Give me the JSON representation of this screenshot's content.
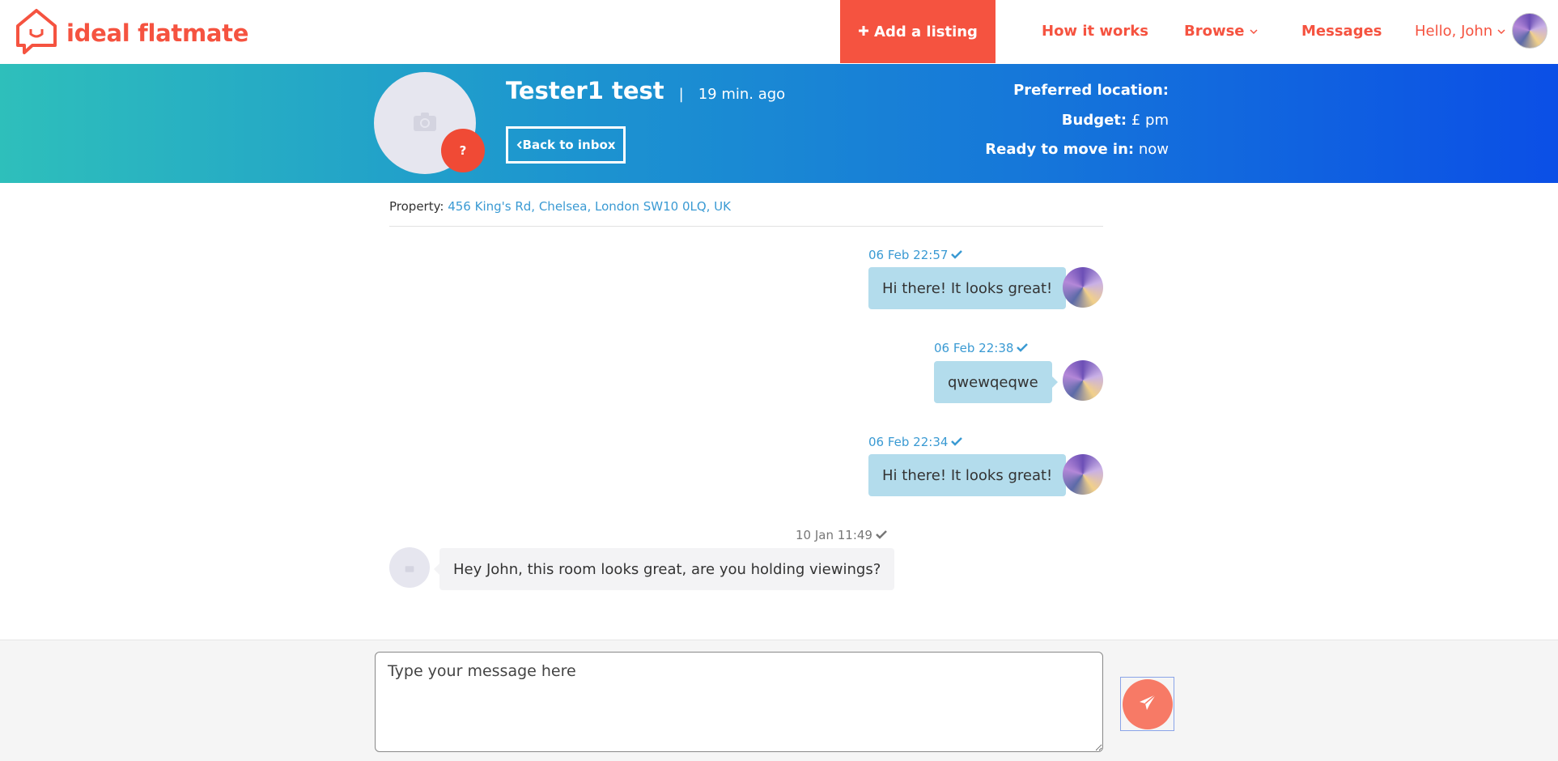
{
  "brand": {
    "name": "ideal flatmate",
    "color": "#f55340"
  },
  "nav": {
    "add_listing": "Add a listing",
    "how_it_works": "How it works",
    "browse": "Browse",
    "messages": "Messages",
    "greeting": "Hello, John"
  },
  "profile": {
    "name": "Tester1 test",
    "separator": "|",
    "last_seen": "19 min. ago",
    "badge": "?",
    "back_button": "Back to inbox",
    "preferred_location_label": "Preferred location:",
    "preferred_location_value": "",
    "budget_label": "Budget:",
    "budget_value": "£ pm",
    "move_in_label": "Ready to move in:",
    "move_in_value": "now"
  },
  "property": {
    "label": "Property:",
    "address": "456 King's Rd, Chelsea, London SW10 0LQ, UK"
  },
  "messages": [
    {
      "time": "06 Feb 22:57",
      "text": "Hi there! It looks great!",
      "sender": "me",
      "read": true
    },
    {
      "time": "06 Feb 22:38",
      "text": "qwewqeqwe",
      "sender": "me",
      "read": true
    },
    {
      "time": "06 Feb 22:34",
      "text": "Hi there! It looks great!",
      "sender": "me",
      "read": true
    },
    {
      "time": "10 Jan 11:49",
      "text": "Hey John, this room looks great, are you holding viewings?",
      "sender": "them",
      "read": true
    }
  ],
  "composer": {
    "placeholder": "Type your message here"
  },
  "icons": {
    "logo": "house-speech-bubble-icon",
    "plus": "plus-icon",
    "chevron": "chevron-down-icon",
    "camera": "camera-icon",
    "check": "check-icon",
    "send": "paper-plane-icon"
  },
  "colors": {
    "accent": "#f55340",
    "link_blue": "#3a9ad3",
    "bubble_mine": "#b3dcec",
    "bubble_theirs": "#f3f3f5",
    "band_start": "#2ebfbb",
    "band_end": "#0b4fe6"
  }
}
